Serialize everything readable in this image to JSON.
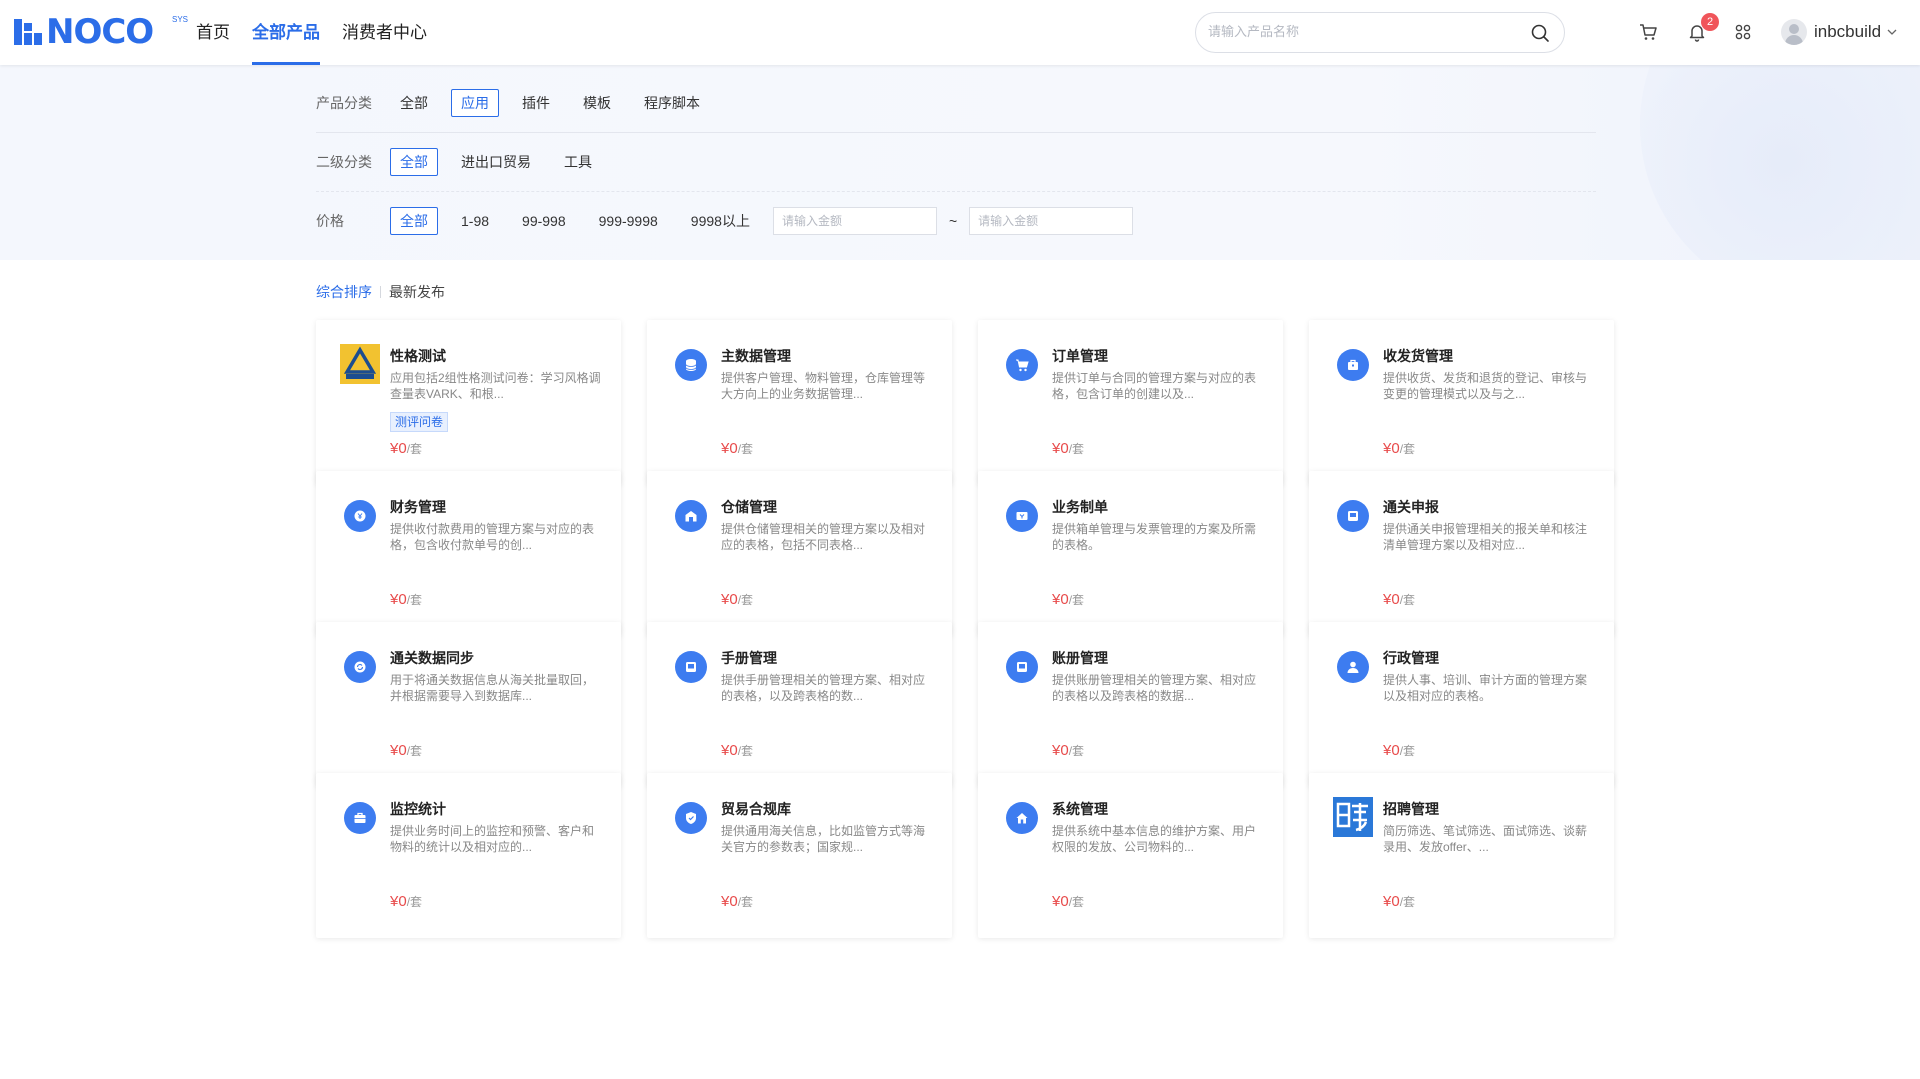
{
  "brand": {
    "name": "NOCO",
    "sup": "SYS"
  },
  "nav": [
    {
      "label": "首页",
      "active": false
    },
    {
      "label": "全部产品",
      "active": true
    },
    {
      "label": "消费者中心",
      "active": false
    }
  ],
  "search": {
    "placeholder": "请输入产品名称"
  },
  "header": {
    "notification_count": "2",
    "username": "inbcbuild"
  },
  "filters": {
    "category": {
      "label": "产品分类",
      "options": [
        "全部",
        "应用",
        "插件",
        "模板",
        "程序脚本"
      ],
      "selected": "应用"
    },
    "subcategory": {
      "label": "二级分类",
      "options": [
        "全部",
        "进出口贸易",
        "工具"
      ],
      "selected": "全部"
    },
    "price": {
      "label": "价格",
      "options": [
        "全部",
        "1-98",
        "99-998",
        "999-9998",
        "9998以上"
      ],
      "selected": "全部",
      "min_placeholder": "请输入金额",
      "max_placeholder": "请输入金额",
      "separator": "~"
    }
  },
  "sort": {
    "options": [
      "综合排序",
      "最新发布"
    ],
    "selected": "综合排序"
  },
  "products": [
    {
      "title": "性格测试",
      "desc": "应用包括2组性格测试问卷：学习风格调查量表VARK、和根...",
      "tag": "测评问卷",
      "price": "¥0",
      "unit": "/套",
      "icon": "logo-image"
    },
    {
      "title": "主数据管理",
      "desc": "提供客户管理、物料管理，仓库管理等大方向上的业务数据管理...",
      "tag": "",
      "price": "¥0",
      "unit": "/套",
      "icon": "database-icon"
    },
    {
      "title": "订单管理",
      "desc": "提供订单与合同的管理方案与对应的表格，包含订单的创建以及...",
      "tag": "",
      "price": "¥0",
      "unit": "/套",
      "icon": "cart-icon"
    },
    {
      "title": "收发货管理",
      "desc": "提供收货、发货和退货的登记、审核与变更的管理模式以及与之...",
      "tag": "",
      "price": "¥0",
      "unit": "/套",
      "icon": "package-icon"
    },
    {
      "title": "财务管理",
      "desc": "提供收付款费用的管理方案与对应的表格，包含收付款单号的创...",
      "tag": "",
      "price": "¥0",
      "unit": "/套",
      "icon": "finance-icon"
    },
    {
      "title": "仓储管理",
      "desc": "提供仓储管理相关的管理方案以及相对应的表格，包括不同表格...",
      "tag": "",
      "price": "¥0",
      "unit": "/套",
      "icon": "warehouse-icon"
    },
    {
      "title": "业务制单",
      "desc": "提供箱单管理与发票管理的方案及所需的表格。",
      "tag": "",
      "price": "¥0",
      "unit": "/套",
      "icon": "invoice-icon"
    },
    {
      "title": "通关申报",
      "desc": "提供通关申报管理相关的报关单和核注清单管理方案以及相对应...",
      "tag": "",
      "price": "¥0",
      "unit": "/套",
      "icon": "declare-icon"
    },
    {
      "title": "通关数据同步",
      "desc": "用于将通关数据信息从海关批量取回，并根据需要导入到数据库...",
      "tag": "",
      "price": "¥0",
      "unit": "/套",
      "icon": "sync-icon"
    },
    {
      "title": "手册管理",
      "desc": "提供手册管理相关的管理方案、相对应的表格，以及跨表格的数...",
      "tag": "",
      "price": "¥0",
      "unit": "/套",
      "icon": "book-icon"
    },
    {
      "title": "账册管理",
      "desc": "提供账册管理相关的管理方案、相对应的表格以及跨表格的数据...",
      "tag": "",
      "price": "¥0",
      "unit": "/套",
      "icon": "ledger-icon"
    },
    {
      "title": "行政管理",
      "desc": "提供人事、培训、审计方面的管理方案以及相对应的表格。",
      "tag": "",
      "price": "¥0",
      "unit": "/套",
      "icon": "person-icon"
    },
    {
      "title": "监控统计",
      "desc": "提供业务时间上的监控和预警、客户和物料的统计以及相对应的...",
      "tag": "",
      "price": "¥0",
      "unit": "/套",
      "icon": "briefcase-icon"
    },
    {
      "title": "贸易合规库",
      "desc": "提供通用海关信息，比如监管方式等海关官方的参数表；国家规...",
      "tag": "",
      "price": "¥0",
      "unit": "/套",
      "icon": "shield-icon"
    },
    {
      "title": "系统管理",
      "desc": "提供系统中基本信息的维护方案、用户权限的发放、公司物料的...",
      "tag": "",
      "price": "¥0",
      "unit": "/套",
      "icon": "home-icon"
    },
    {
      "title": "招聘管理",
      "desc": "简历筛选、笔试筛选、面试筛选、谈薪录用、发放offer、...",
      "tag": "",
      "price": "¥0",
      "unit": "/套",
      "icon": "pin-image"
    }
  ],
  "colors": {
    "accent": "#2b6de8",
    "price": "#e84b4b",
    "icon_bg": "#3d7cf0"
  }
}
